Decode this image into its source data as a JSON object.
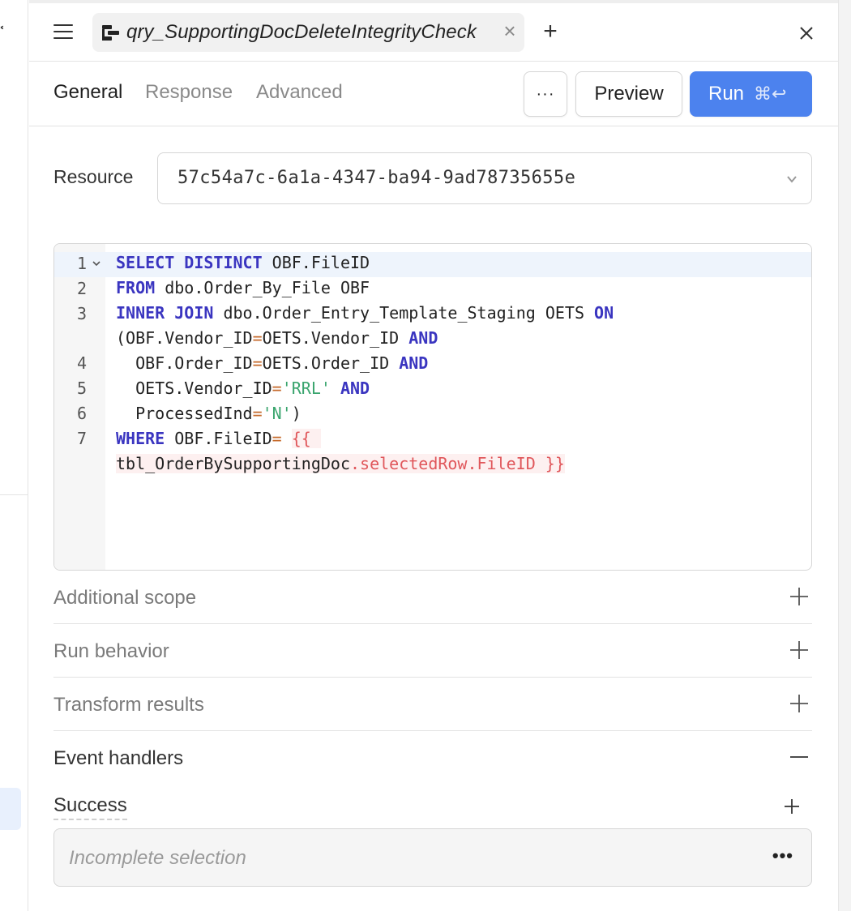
{
  "tab": {
    "title": "qry_SupportingDocDeleteIntegrityCheck"
  },
  "subnav": {
    "tabs": [
      "General",
      "Response",
      "Advanced"
    ],
    "more_label": "···",
    "preview_label": "Preview",
    "run_label": "Run",
    "run_shortcut": "⌘↩"
  },
  "resource": {
    "label": "Resource",
    "value": "57c54a7c-6a1a-4347-ba94-9ad78735655e"
  },
  "editor": {
    "line_numbers": [
      "1",
      "2",
      "3",
      "4",
      "5",
      "6",
      "7"
    ],
    "lines": {
      "l1": {
        "kw1": "SELECT DISTINCT",
        "rest": " OBF.FileID"
      },
      "l2": {
        "kw1": "FROM",
        "rest": " dbo.Order_By_File OBF"
      },
      "l3a": {
        "kw1": "INNER JOIN",
        "mid": " dbo.Order_Entry_Template_Staging OETS ",
        "kw2": "ON"
      },
      "l3b": {
        "a": "(OBF.Vendor_ID",
        "op": "=",
        "b": "OETS.Vendor_ID ",
        "kw": "AND"
      },
      "l4": {
        "a": "  OBF.Order_ID",
        "op": "=",
        "b": "OETS.Order_ID ",
        "kw": "AND"
      },
      "l5": {
        "a": "  OETS.Vendor_ID",
        "op": "=",
        "str": "'RRL'",
        "b": " ",
        "kw": "AND"
      },
      "l6": {
        "a": "  ProcessedInd",
        "op": "=",
        "str": "'N'",
        "b": ")"
      },
      "l7a": {
        "kw": "WHERE",
        "a": " OBF.FileID",
        "op": "=",
        "b": " ",
        "tpl_open": "{{ "
      },
      "l7b": {
        "obj": "tbl_OrderBySupportingDoc",
        "prop": ".selectedRow.FileID",
        "tpl_close": " }}"
      }
    }
  },
  "sections": [
    {
      "title": "Additional scope",
      "expanded": false
    },
    {
      "title": "Run behavior",
      "expanded": false
    },
    {
      "title": "Transform results",
      "expanded": false
    },
    {
      "title": "Event handlers",
      "expanded": true
    }
  ],
  "event_handlers": {
    "success_label": "Success",
    "placeholder": "Incomplete selection",
    "more_label": "•••"
  },
  "colors": {
    "accent": "#4c82ee",
    "keyword": "#3a35c0",
    "string": "#3aa56e",
    "template": "#e0575b"
  }
}
